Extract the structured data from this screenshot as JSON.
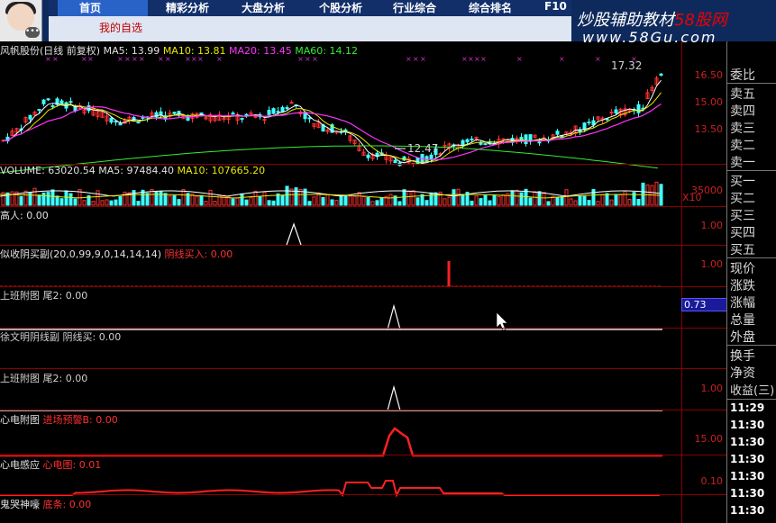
{
  "header": {
    "tabs": [
      "首页",
      "精彩分析",
      "大盘分析",
      "个股分析",
      "行业综合",
      "综合排名",
      "F10"
    ],
    "active_tab": "自选",
    "sub_tab": "我的自选",
    "brand": "炒股辅助教材",
    "brand_red": "58股网",
    "brand_url": "www.58Gu.com"
  },
  "main": {
    "title": "风帆股份(日线 前复权)",
    "ma5": "MA5: 13.99",
    "ma10": "MA10: 13.81",
    "ma20": "MA20: 13.45",
    "ma60": "MA60: 14.12",
    "hi_label": "17.32",
    "lo_label": "12.47",
    "y_ticks": [
      "16.50",
      "15.00",
      "13.50"
    ]
  },
  "volume": {
    "label": "VOLUME: 63020.54",
    "ma5": "MA5: 97484.40",
    "ma10": "MA10: 107665.20",
    "tick": "35000",
    "unit": "X10"
  },
  "panels": [
    {
      "name": "高人",
      "value": ": 0.00",
      "extra": "",
      "tick": "1.00"
    },
    {
      "name": "似收阴买副(20,0,99,9,0,14,14,14)",
      "value": "",
      "extra": "阴线买入: 0.00",
      "tick": "1.00"
    },
    {
      "name": "上班附图 尾2: 0.00",
      "value": "",
      "extra": "",
      "tick": "0.73"
    },
    {
      "name": "徐文明阴线副 阴线买: 0.00",
      "value": "",
      "extra": "",
      "tick": ""
    },
    {
      "name": "上班附图 尾2: 0.00",
      "value": "",
      "extra": "",
      "tick": "1.00"
    },
    {
      "name": "心电附图",
      "value": "",
      "extra": "进场预警B: 0.00",
      "tick": "15.00"
    },
    {
      "name": "心电感应",
      "value": "",
      "extra": "心电图: 0.01",
      "tick": "0.10"
    },
    {
      "name": "鬼哭神嚎",
      "value": "",
      "extra": "底条: 0.00",
      "tick": ""
    }
  ],
  "right_column": {
    "labels": [
      "委比",
      "卖五",
      "卖四",
      "卖三",
      "卖二",
      "卖一",
      "买一",
      "买二",
      "买三",
      "买四",
      "买五",
      "现价",
      "涨跌",
      "涨幅",
      "总量",
      "外盘",
      "换手",
      "净资",
      "收益(三)"
    ],
    "times": [
      "11:29",
      "11:30",
      "11:30",
      "11:30",
      "11:30",
      "11:30",
      "11:30",
      "11:30",
      "11:30"
    ]
  },
  "colors": {
    "up": "#ff3030",
    "down": "#40ffff",
    "ma5": "#ffffff",
    "ma10": "#e8e800",
    "ma20": "#ff33ff",
    "ma60": "#33ee33"
  }
}
